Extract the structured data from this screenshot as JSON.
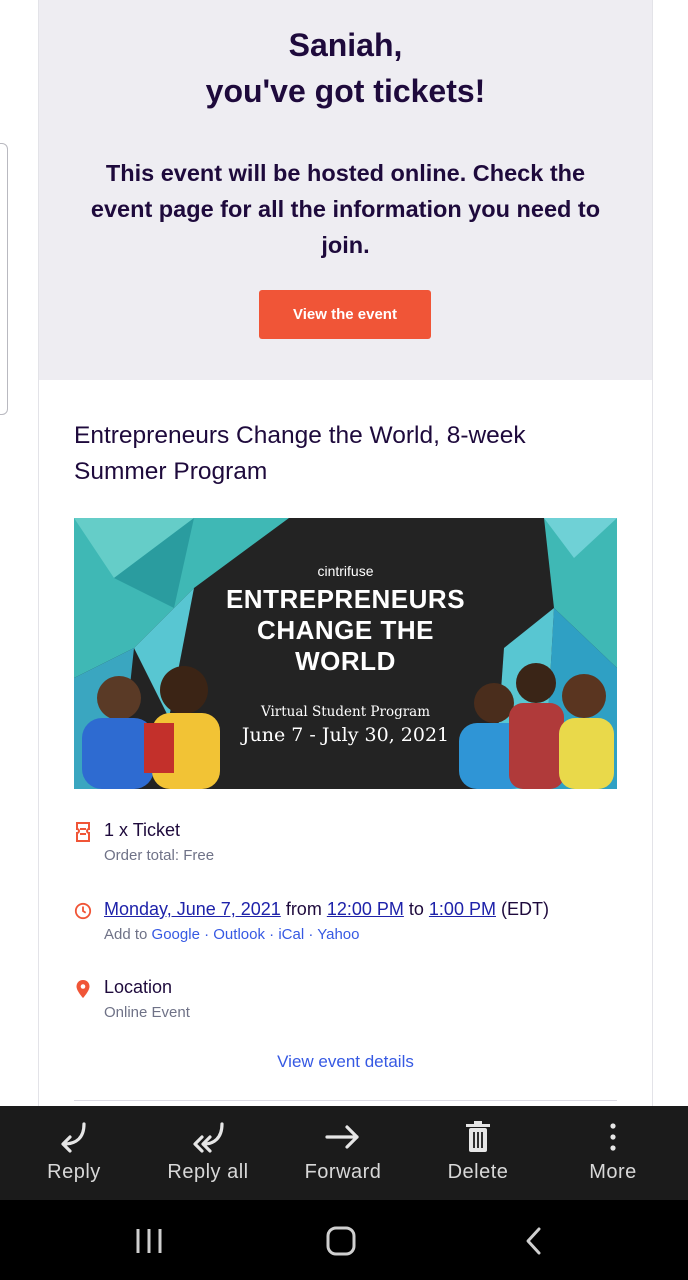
{
  "header": {
    "line1": "Saniah,",
    "line2": "you've got tickets!",
    "message": "This event will be hosted online. Check the event page for all the information you need to join.",
    "cta_label": "View the event"
  },
  "event": {
    "title": "Entrepreneurs Change the World, 8-week Summer Program",
    "banner": {
      "brand": "cintrifuse",
      "title_line1": "ENTREPRENEURS",
      "title_line2": "CHANGE THE",
      "title_line3": "WORLD",
      "subtitle": "Virtual Student Program",
      "dates": "June 7 - July 30, 2021"
    },
    "ticket": {
      "label": "1 x Ticket",
      "order_total": "Order total: Free"
    },
    "datetime": {
      "date": "Monday, June 7, 2021",
      "from_word": "from",
      "start": "12:00 PM",
      "to_word": "to",
      "end": "1:00 PM",
      "tz": "(EDT)",
      "add_to": "Add to",
      "calendars": [
        "Google",
        "Outlook",
        "iCal",
        "Yahoo"
      ],
      "sep": "·"
    },
    "location": {
      "label": "Location",
      "value": "Online Event"
    },
    "details_link": "View event details"
  },
  "toolbar": {
    "items": [
      {
        "label": "Reply",
        "icon": "reply-icon"
      },
      {
        "label": "Reply all",
        "icon": "reply-all-icon"
      },
      {
        "label": "Forward",
        "icon": "forward-icon"
      },
      {
        "label": "Delete",
        "icon": "trash-icon"
      },
      {
        "label": "More",
        "icon": "more-vertical-icon"
      }
    ]
  },
  "navbar": {
    "icons": [
      "recent-apps-icon",
      "home-icon",
      "back-icon"
    ]
  },
  "colors": {
    "brand_orange": "#f05537",
    "heading_navy": "#1e0a3c",
    "link_blue": "#3659e3",
    "hero_bg": "#eeedf2",
    "toolbar_bg": "#1b1b1b"
  }
}
